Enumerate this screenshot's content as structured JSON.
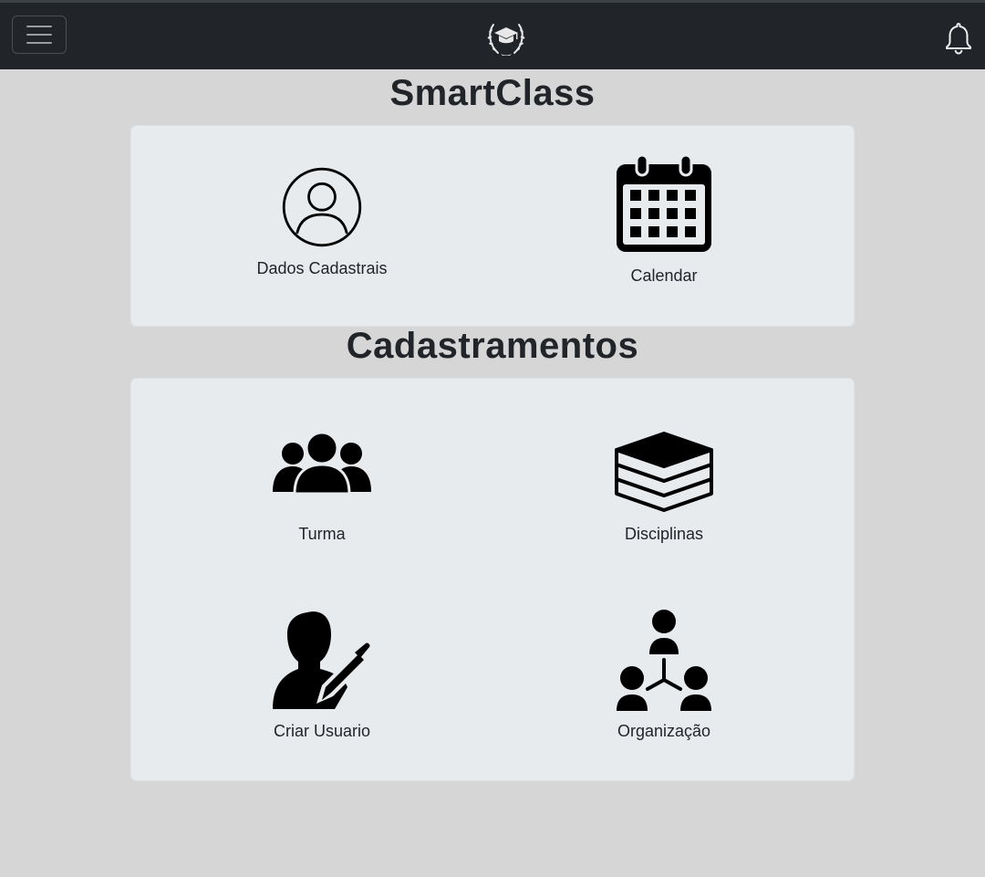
{
  "header": {
    "menu_icon": "hamburger-icon",
    "logo_icon": "graduation-cap-laurel-logo",
    "notifications_icon": "bell-icon",
    "background": "#212529"
  },
  "sections": [
    {
      "title": "SmartClass",
      "items": [
        {
          "label": "Dados Cadastrais",
          "icon": "user-circle-icon"
        },
        {
          "label": "Calendar",
          "icon": "calendar-icon"
        }
      ]
    },
    {
      "title": "Cadastramentos",
      "items": [
        {
          "label": "Turma",
          "icon": "users-group-icon"
        },
        {
          "label": "Disciplinas",
          "icon": "books-icon"
        },
        {
          "label": "Criar Usuario",
          "icon": "user-edit-icon"
        },
        {
          "label": "Organização",
          "icon": "organization-icon"
        }
      ]
    }
  ],
  "colors": {
    "page_background": "#d6d6d6",
    "card_background": "#e8ebee",
    "text": "#212529"
  }
}
